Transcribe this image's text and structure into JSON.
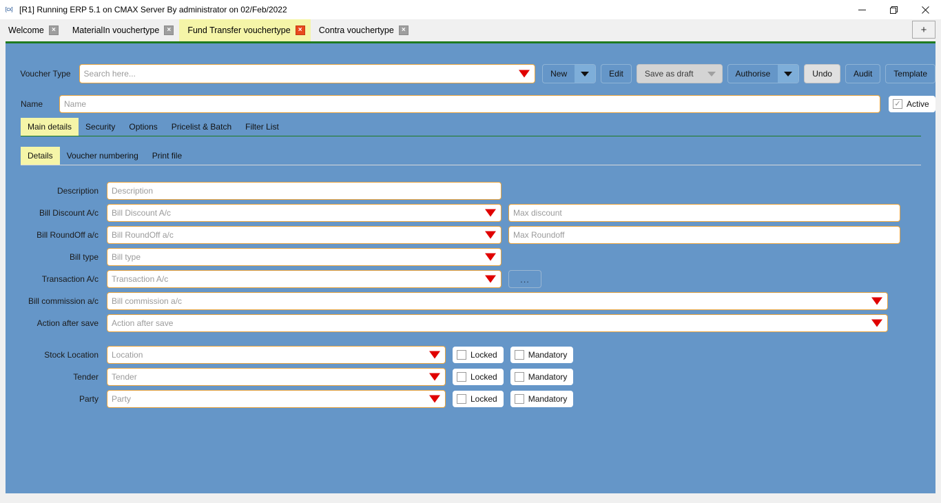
{
  "window": {
    "title": "[R1] Running ERP 5.1 on CMAX Server By administrator on 02/Feb/2022",
    "app_icon": "[cx]",
    "minimize_label": "Minimize",
    "maximize_label": "Maximize",
    "close_label": "Close"
  },
  "tabstrip": {
    "add_tab_label": "+",
    "close_glyph": "×",
    "tabs": [
      {
        "label": "Welcome",
        "active": false
      },
      {
        "label": "MaterialIn vouchertype",
        "active": false
      },
      {
        "label": "Fund Transfer vouchertype",
        "active": true
      },
      {
        "label": "Contra vouchertype",
        "active": false
      }
    ]
  },
  "header": {
    "voucher_type_label": "Voucher Type",
    "voucher_type_placeholder": "Search here...",
    "name_label": "Name",
    "name_placeholder": "Name",
    "active_label": "Active",
    "active_checked_glyph": "✓"
  },
  "toolbar": {
    "new_label": "New",
    "edit_label": "Edit",
    "save_as_draft_label": "Save as draft",
    "authorise_label": "Authorise",
    "undo_label": "Undo",
    "audit_label": "Audit",
    "template_label": "Template"
  },
  "tabs_primary": [
    {
      "label": "Main details",
      "active": true
    },
    {
      "label": "Security",
      "active": false
    },
    {
      "label": "Options",
      "active": false
    },
    {
      "label": "Pricelist & Batch",
      "active": false
    },
    {
      "label": "Filter List",
      "active": false
    }
  ],
  "tabs_secondary": [
    {
      "label": "Details",
      "active": true
    },
    {
      "label": "Voucher numbering",
      "active": false
    },
    {
      "label": "Print file",
      "active": false
    }
  ],
  "form": {
    "description": {
      "label": "Description",
      "placeholder": "Description"
    },
    "bill_discount": {
      "label": "Bill Discount A/c",
      "placeholder": "Bill Discount A/c"
    },
    "max_discount": {
      "placeholder": "Max discount"
    },
    "bill_roundoff": {
      "label": "Bill RoundOff a/c",
      "placeholder": "Bill RoundOff a/c"
    },
    "max_roundoff": {
      "placeholder": "Max Roundoff"
    },
    "bill_type": {
      "label": "Bill type",
      "placeholder": "Bill type"
    },
    "transaction_ac": {
      "label": "Transaction A/c",
      "placeholder": "Transaction A/c",
      "browse_label": "..."
    },
    "bill_commission": {
      "label": "Bill commission a/c",
      "placeholder": "Bill commission a/c"
    },
    "action_after_save": {
      "label": "Action after save",
      "placeholder": "Action after save"
    },
    "stock_location": {
      "label": "Stock Location",
      "placeholder": "Location"
    },
    "tender": {
      "label": "Tender",
      "placeholder": "Tender"
    },
    "party": {
      "label": "Party",
      "placeholder": "Party"
    },
    "locked_label": "Locked",
    "mandatory_label": "Mandatory"
  },
  "colors": {
    "content_background": "#6596c8",
    "accent_green": "#1f7a1f",
    "field_border": "#e8a33d",
    "dropdown_arrow": "#e00000",
    "active_tab": "#f5f5a8",
    "active_close": "#e8491d"
  }
}
